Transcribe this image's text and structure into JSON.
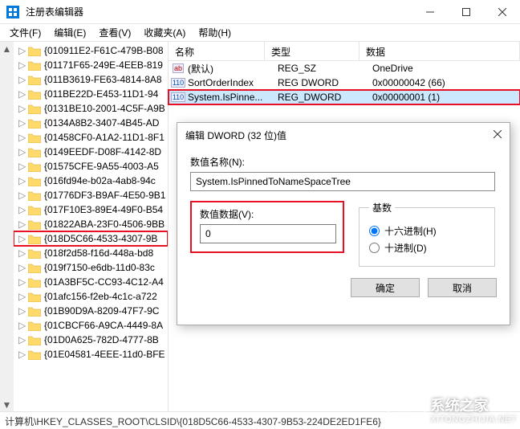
{
  "window": {
    "title": "注册表编辑器"
  },
  "menu": {
    "file": "文件(F)",
    "edit": "编辑(E)",
    "view": "查看(V)",
    "favorites": "收藏夹(A)",
    "help": "帮助(H)"
  },
  "tree": {
    "items": [
      "{010911E2-F61C-479B-B08",
      "{01171F65-249E-4EEB-819",
      "{011B3619-FE63-4814-8A8",
      "{011BE22D-E453-11D1-94",
      "{0131BE10-2001-4C5F-A9B",
      "{0134A8B2-3407-4B45-AD",
      "{01458CF0-A1A2-11D1-8F1",
      "{0149EEDF-D08F-4142-8D",
      "{01575CFE-9A55-4003-A5",
      "{016fd94e-b02a-4ab8-94c",
      "{01776DF3-B9AF-4E50-9B1",
      "{017F10E3-89E4-49F0-B54",
      "{01822ABA-23F0-4506-9BB",
      "{018D5C66-4533-4307-9B",
      "{018f2d58-f16d-448a-bd8",
      "{019f7150-e6db-11d0-83c",
      "{01A3BF5C-CC93-4C12-A4",
      "{01afc156-f2eb-4c1c-a722",
      "{01B90D9A-8209-47F7-9C",
      "{01CBCF66-A9CA-4449-8A",
      "{01D0A625-782D-4777-8B",
      "{01E04581-4EEE-11d0-BFE"
    ],
    "selected_index": 13
  },
  "list": {
    "header": {
      "name": "名称",
      "type": "类型",
      "data": "数据"
    },
    "rows": [
      {
        "icon": "str",
        "name": "(默认)",
        "type": "REG_SZ",
        "data": "OneDrive"
      },
      {
        "icon": "dw",
        "name": "SortOrderIndex",
        "type": "REG DWORD",
        "data": "0x00000042 (66)"
      },
      {
        "icon": "dw",
        "name": "System.IsPinne...",
        "type": "REG_DWORD",
        "data": "0x00000001 (1)"
      }
    ],
    "selected_index": 2
  },
  "dialog": {
    "title": "编辑 DWORD (32 位)值",
    "name_label": "数值名称(N):",
    "name_value": "System.IsPinnedToNameSpaceTree",
    "data_label": "数值数据(V):",
    "data_value": "0",
    "radix_label": "基数",
    "hex_label": "十六进制(H)",
    "dec_label": "十进制(D)",
    "radix_selected": "hex",
    "ok": "确定",
    "cancel": "取消"
  },
  "statusbar": {
    "path": "计算机\\HKEY_CLASSES_ROOT\\CLSID\\{018D5C66-4533-4307-9B53-224DE2ED1FE6}"
  },
  "watermark": {
    "brand": "系统之家",
    "url": "XITONGZHIJIA.NET"
  }
}
